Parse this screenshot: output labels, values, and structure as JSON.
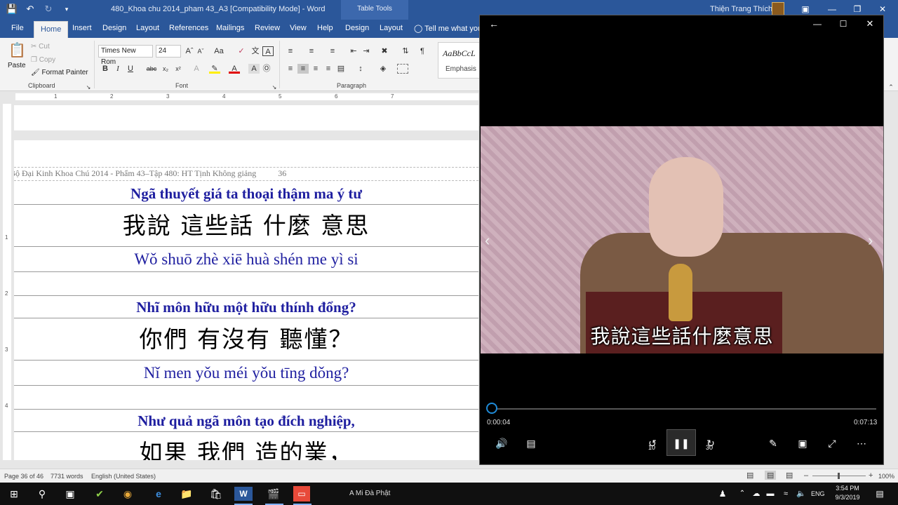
{
  "word": {
    "title": "480_Khoa chu 2014_pham 43_A3 [Compatibility Mode]  -  Word",
    "table_tools": "Table Tools",
    "user": "Thiện Trang Thích",
    "tabs": [
      "File",
      "Home",
      "Insert",
      "Design",
      "Layout",
      "References",
      "Mailings",
      "Review",
      "View",
      "Help",
      "Design",
      "Layout"
    ],
    "active_tab": "Home",
    "tell_me": "Tell me what you",
    "clipboard": {
      "paste": "Paste",
      "cut": "Cut",
      "copy": "Copy",
      "format_painter": "Format Painter",
      "label": "Clipboard"
    },
    "font": {
      "name": "Times New Rom",
      "size": "24",
      "label": "Font"
    },
    "paragraph": {
      "label": "Paragraph"
    },
    "styles": {
      "sample": "AaBbCcL",
      "name": "Emphasis"
    },
    "ruler_numbers": [
      "1",
      "2",
      "3",
      "4",
      "5",
      "6",
      "7"
    ],
    "vruler_numbers": [
      "1",
      "2",
      "3",
      "4"
    ],
    "header_line": "Bộ Đại Kinh Khoa Chú 2014 - Phẩm 43–Tập 480: HT Tịnh Không giảng",
    "page_number": "36",
    "rows": [
      {
        "kind": "viet",
        "text": "Ngã thuyết giá ta thoại  thậm ma  ý tư"
      },
      {
        "kind": "cjk",
        "text": "我說  這些話  什麼  意思"
      },
      {
        "kind": "pinyin",
        "text": "Wǒ shuō  zhè xiē  huà  shén me  yì si"
      },
      {
        "kind": "blank",
        "text": ""
      },
      {
        "kind": "viet",
        "text": "Nhĩ môn  hữu một hữu  thính đổng?"
      },
      {
        "kind": "cjk",
        "text": "你們  有沒有  聽懂？"
      },
      {
        "kind": "pinyin",
        "text": "Nǐ men  yǒu méi yǒu  tīng dǒng?"
      },
      {
        "kind": "blank",
        "text": ""
      },
      {
        "kind": "viet",
        "text": "Như quả  ngã môn  tạo đích nghiệp,"
      },
      {
        "kind": "cjk",
        "text": "如果  我們  造的業，"
      }
    ],
    "status": {
      "page": "Page 36 of 46",
      "words": "7731 words",
      "language": "English (United States)",
      "zoom": "100%"
    }
  },
  "player": {
    "subtitle": "我說這些話什麼意思",
    "elapsed": "0:00:04",
    "duration": "0:07:13",
    "progress": 0.009,
    "skip_back": "10",
    "skip_forward": "30"
  },
  "taskbar": {
    "running_label": "A Mi Đà Phật",
    "language": "ENG",
    "time": "3:54 PM",
    "date": "9/3/2019"
  },
  "colors": {
    "word_blue": "#2b579a",
    "text_blue": "#1f1fa0",
    "seek_blue": "#1f8bd8"
  }
}
